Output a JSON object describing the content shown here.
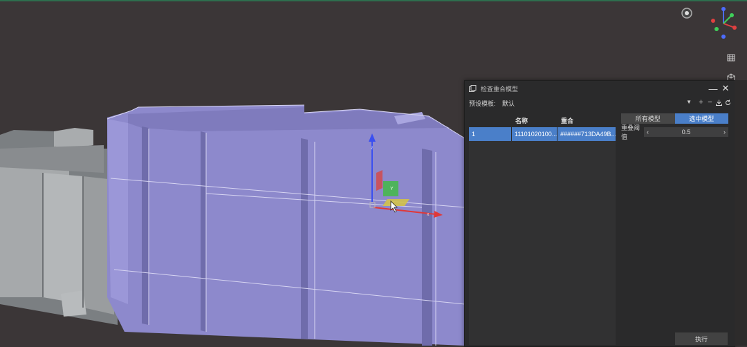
{
  "dialog": {
    "title": "检查重合模型",
    "minimize_icon": "minimize-icon",
    "close_icon": "close-icon",
    "preset_label": "预设模板:",
    "preset_value": "默认",
    "table": {
      "headers": [
        "",
        "名称",
        "重合"
      ],
      "rows": [
        {
          "index": "1",
          "name": "11101020100...",
          "overlap": "######713DA49B..."
        }
      ]
    },
    "tabs": {
      "all": "所有模型",
      "selected": "选中模型",
      "active": "selected"
    },
    "threshold_label": "重叠阈值",
    "threshold_value": "0.5",
    "run_label": "执行"
  },
  "viewport": {
    "gizmo_axes": [
      "x",
      "y",
      "z"
    ],
    "axis_x_label": "x",
    "axis_y_label": "Y",
    "axis_z_label": "z",
    "colors": {
      "background": "#3b3637",
      "selected_mesh": "#8a86c6",
      "grey_mesh": "#9a9ea1",
      "accent": "#4a7fc9"
    }
  }
}
